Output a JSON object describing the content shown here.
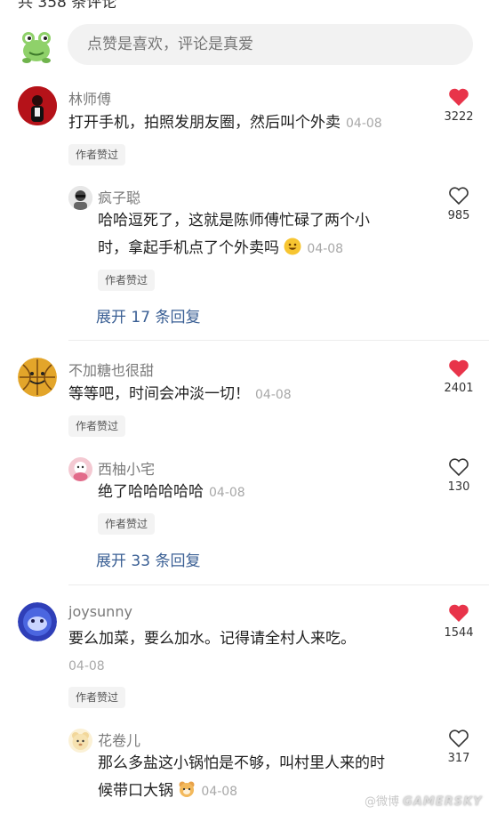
{
  "header": {
    "total_comments": "共 358 条评论"
  },
  "input": {
    "placeholder": "点赞是喜欢，评论是真爱"
  },
  "badge_label": "作者赞过",
  "comments": [
    {
      "user": "林师傅",
      "text": "打开手机，拍照发朋友圈，然后叫个外卖",
      "date": "04-08",
      "likes": "3222",
      "liked": true,
      "reply": {
        "user": "疯子聪",
        "text_line1": "哈哈逗死了，这就是陈师傅忙碌了两个小",
        "text_line2": "时，拿起手机点了个外卖吗",
        "date": "04-08",
        "likes": "985",
        "liked": false
      },
      "expand": "展开 17 条回复"
    },
    {
      "user": "不加糖也很甜",
      "text": "等等吧，时间会冲淡一切！",
      "date": "04-08",
      "likes": "2401",
      "liked": true,
      "reply": {
        "user": "西柚小宅",
        "text_line1": "绝了哈哈哈哈哈",
        "date": "04-08",
        "likes": "130",
        "liked": false
      },
      "expand": "展开 33 条回复"
    },
    {
      "user": "joysunny",
      "text": "要么加菜，要么加水。记得请全村人来吃。",
      "date": "04-08",
      "likes": "1544",
      "liked": true,
      "reply": {
        "user": "花卷儿",
        "text_line1": "那么多盐这小锅怕是不够，叫村里人来的时",
        "text_line2": "候带口大锅",
        "date": "04-08",
        "likes": "317",
        "liked": false
      }
    }
  ],
  "watermark": {
    "prefix": "@微博",
    "brand": "GAMERSKY"
  },
  "colors": {
    "liked_heart": "#e8344a",
    "expand_link": "#3a5f94"
  }
}
